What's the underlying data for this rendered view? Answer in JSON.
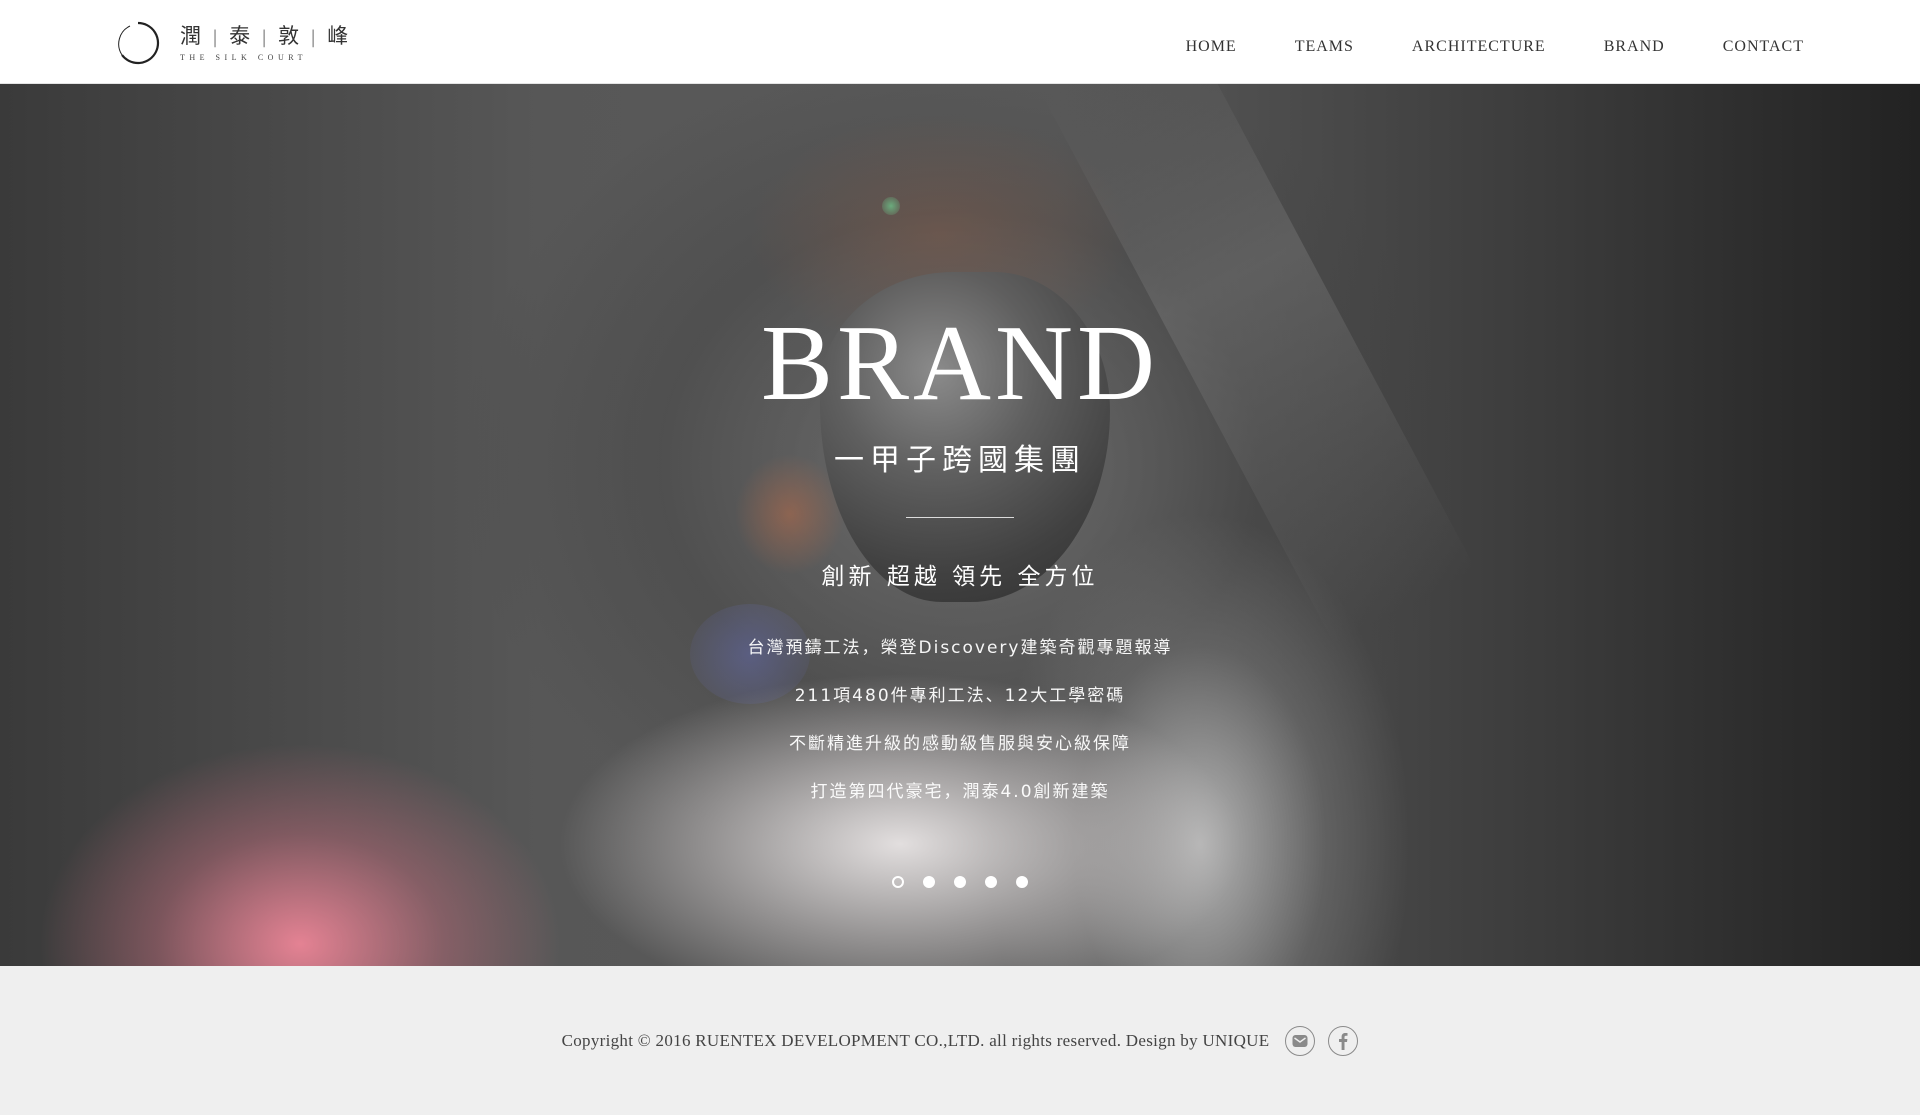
{
  "header": {
    "logo_chars": [
      "潤",
      "泰",
      "敦",
      "峰"
    ],
    "logo_separator": "|",
    "logo_subtitle": "The Silk Court",
    "nav": [
      {
        "label": "HOME"
      },
      {
        "label": "TEAMS"
      },
      {
        "label": "ARCHITECTURE"
      },
      {
        "label": "BRAND"
      },
      {
        "label": "CONTACT"
      }
    ]
  },
  "hero": {
    "title": "BRAND",
    "subtitle": "一甲子跨國集團",
    "tagline": "創新 超越 領先 全方位",
    "lines": [
      "台灣預鑄工法，榮登Discovery建築奇觀專題報導",
      "211項480件專利工法、12大工學密碼",
      "不斷精進升級的感動級售服與安心級保障",
      "打造第四代豪宅，潤泰4.0創新建築"
    ],
    "slides": {
      "count": 5,
      "active_index": 1
    }
  },
  "footer": {
    "copyright": "Copyright © 2016 RUENTEX DEVELOPMENT CO.,LTD. all rights reserved. Design by UNIQUE",
    "icons": [
      "mail-icon",
      "facebook-icon"
    ]
  },
  "colors": {
    "header_bg": "#ffffff",
    "footer_bg": "#efefef",
    "text_dark": "#333333",
    "hero_text": "#ffffff",
    "icon_stroke": "#8a8a8a"
  }
}
